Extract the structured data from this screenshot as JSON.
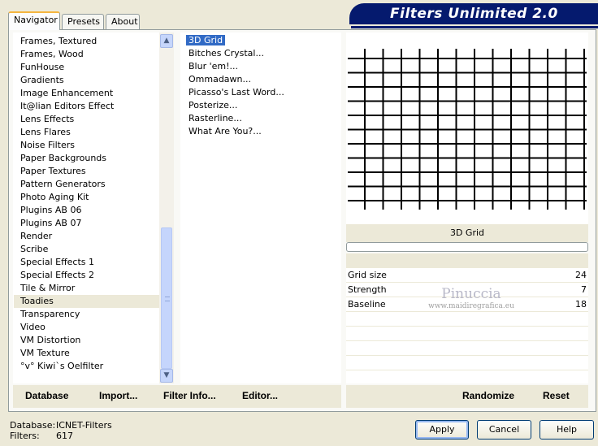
{
  "tabs": [
    {
      "label": "Navigator"
    },
    {
      "label": "Presets"
    },
    {
      "label": "About"
    }
  ],
  "logo": "Filters Unlimited 2.0",
  "categories": [
    {
      "label": "Frames, Textured"
    },
    {
      "label": "Frames, Wood"
    },
    {
      "label": "FunHouse"
    },
    {
      "label": "Gradients"
    },
    {
      "label": "Image Enhancement"
    },
    {
      "label": "It@lian Editors Effect"
    },
    {
      "label": "Lens Effects"
    },
    {
      "label": "Lens Flares"
    },
    {
      "label": "Noise Filters"
    },
    {
      "label": "Paper Backgrounds"
    },
    {
      "label": "Paper Textures"
    },
    {
      "label": "Pattern Generators"
    },
    {
      "label": "Photo Aging Kit"
    },
    {
      "label": "Plugins AB 06"
    },
    {
      "label": "Plugins AB 07"
    },
    {
      "label": "Render"
    },
    {
      "label": "Scribe"
    },
    {
      "label": "Special Effects 1"
    },
    {
      "label": "Special Effects 2"
    },
    {
      "label": "Tile & Mirror"
    },
    {
      "label": "Toadies"
    },
    {
      "label": "Transparency"
    },
    {
      "label": "Video"
    },
    {
      "label": "VM Distortion"
    },
    {
      "label": "VM Texture"
    },
    {
      "label": "°v° Kiwi`s Oelfilter"
    }
  ],
  "selected_category": "Toadies",
  "filters": [
    {
      "label": "3D Grid"
    },
    {
      "label": "Bitches Crystal..."
    },
    {
      "label": "Blur 'em!..."
    },
    {
      "label": "Ommadawn..."
    },
    {
      "label": "Picasso's Last Word..."
    },
    {
      "label": "Posterize..."
    },
    {
      "label": "Rasterline..."
    },
    {
      "label": "What Are You?..."
    }
  ],
  "selected_filter": "3D Grid",
  "preview_filter_name": "3D Grid",
  "params": [
    {
      "name": "Grid size",
      "value": "24"
    },
    {
      "name": "Strength",
      "value": "7"
    },
    {
      "name": "Baseline",
      "value": "18"
    }
  ],
  "watermark": {
    "line1": "Pinuccia",
    "line2": "www.maidiregrafica.eu"
  },
  "buttons": {
    "database": "Database",
    "import": "Import...",
    "filter_info": "Filter Info...",
    "editor": "Editor...",
    "randomize": "Randomize",
    "reset": "Reset",
    "apply": "Apply",
    "cancel": "Cancel",
    "help": "Help"
  },
  "status": {
    "database_label": "Database:",
    "database_value": "ICNET-Filters",
    "filters_label": "Filters:",
    "filters_value": "617"
  },
  "scroll_icons": {
    "up": "arrow-up-icon",
    "down": "arrow-down-icon"
  }
}
